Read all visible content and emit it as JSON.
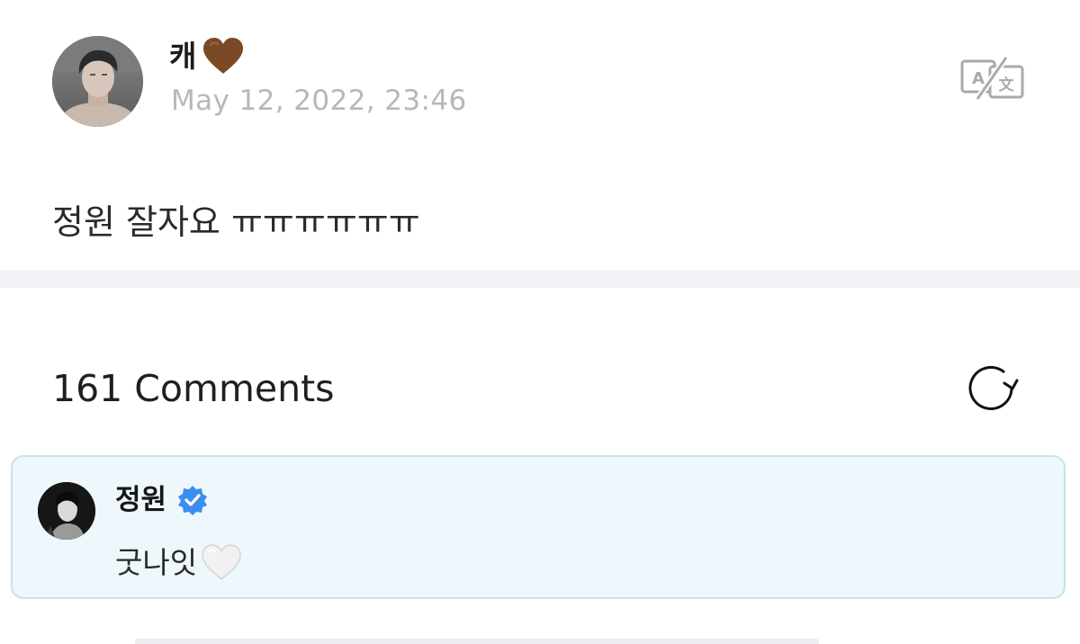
{
  "post": {
    "author": "캐",
    "timestamp": "May 12, 2022, 23:46",
    "body": "정원 잘자요 ㅠㅠㅠㅠㅠㅠ",
    "translate_icon": "translate-icon",
    "author_badge_icon": "brown-heart-icon"
  },
  "comments": {
    "count_label": "161 Comments",
    "refresh_icon": "refresh-icon",
    "highlighted": {
      "author": "정원",
      "verified_icon": "verified-badge-icon",
      "text": "굿나잇",
      "emoji_icon": "white-heart-icon"
    }
  },
  "colors": {
    "timestamp": "#b7b7be",
    "divider": "#f3f3f7",
    "comment_bg": "#eef7fb",
    "comment_border": "#c9e2ee",
    "verified": "#3b8df0",
    "brown_heart": "#7a4a27"
  }
}
